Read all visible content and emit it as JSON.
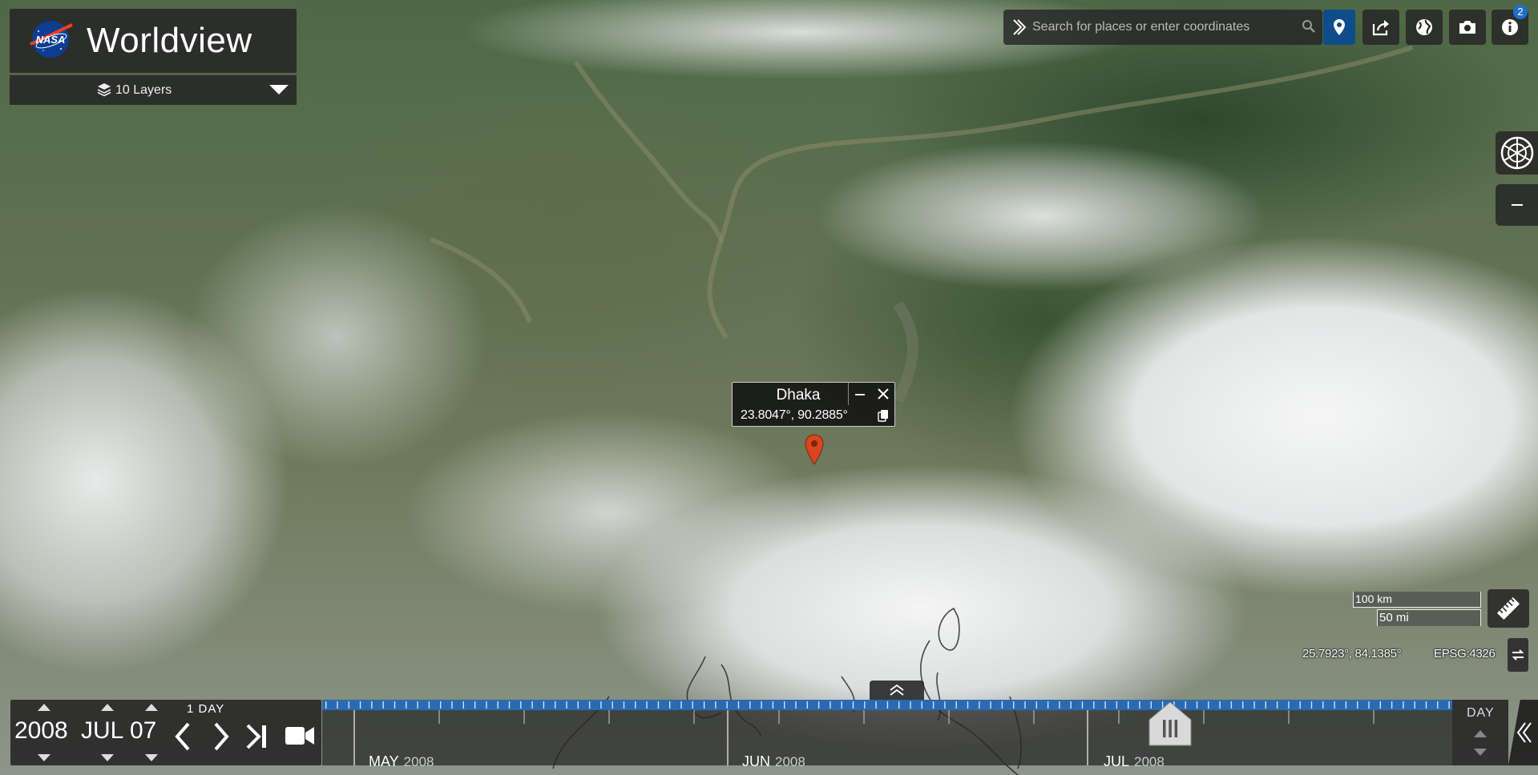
{
  "app": {
    "title": "Worldview",
    "logo_text": "NASA"
  },
  "layers": {
    "label": "10 Layers"
  },
  "search": {
    "placeholder": "Search for places or enter coordinates"
  },
  "toolbar": {
    "info_badge": "2"
  },
  "popup": {
    "title": "Dhaka",
    "coordinates": "23.8047°, 90.2885°"
  },
  "scale": {
    "km": "100 km",
    "mi": "50 mi"
  },
  "map_readout": {
    "coordinates": "25.7923°, 84.1385°",
    "projection": "EPSG:4326"
  },
  "date": {
    "year": "2008",
    "month": "JUL",
    "day": "07",
    "step": "1  DAY"
  },
  "timeline": {
    "months": [
      {
        "month": "MAY",
        "year": "2008"
      },
      {
        "month": "JUN",
        "year": "2008"
      },
      {
        "month": "JUL",
        "year": "2008"
      }
    ],
    "zoom_level": "DAY"
  },
  "icons": {
    "chevron": "chevron-right-double-icon",
    "search": "search-icon",
    "location": "location-pin-icon",
    "share": "share-icon",
    "projection": "globe-icon",
    "snapshot": "camera-icon",
    "info": "info-icon",
    "measure": "ruler-icon"
  },
  "colors": {
    "accent": "#0e4c8a",
    "timeline_band": "#2a6ab0",
    "marker": "#d9451e",
    "panel": "#282828"
  }
}
